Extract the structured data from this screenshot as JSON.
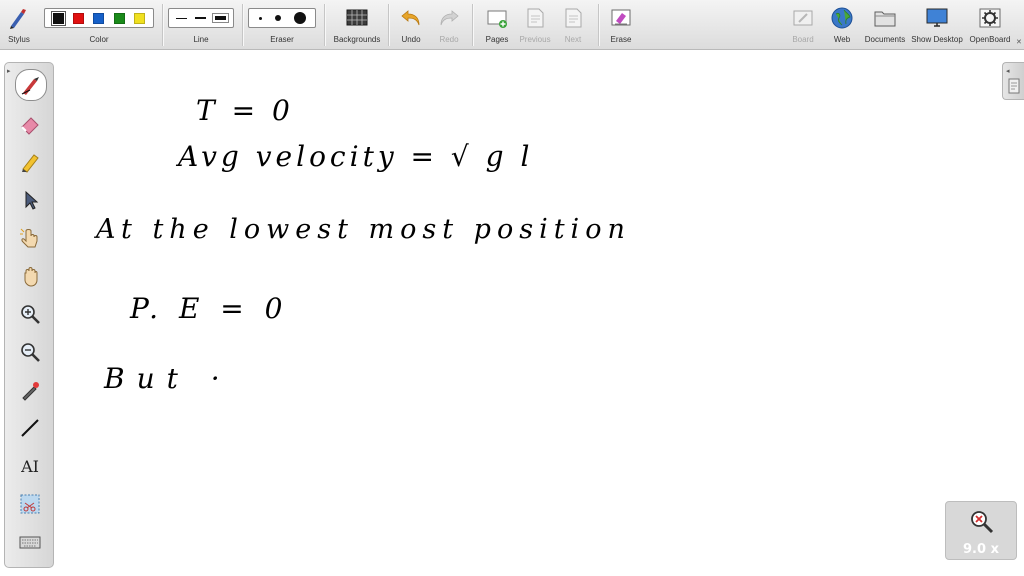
{
  "toolbar": {
    "stylus": "Stylus",
    "color": "Color",
    "line": "Line",
    "eraser": "Eraser",
    "backgrounds": "Backgrounds",
    "undo": "Undo",
    "redo": "Redo",
    "pages": "Pages",
    "previous": "Previous",
    "next": "Next",
    "erase": "Erase",
    "board": "Board",
    "web": "Web",
    "documents": "Documents",
    "show_desktop": "Show Desktop",
    "openboard": "OpenBoard"
  },
  "colors": {
    "swatches": [
      "#111111",
      "#e01010",
      "#1660c8",
      "#1a8a1a",
      "#f0e020"
    ],
    "selected_index": 0
  },
  "palette": {
    "tools": [
      "pen-icon",
      "eraser-icon",
      "marker-icon",
      "pointer-icon",
      "hand-pointer-icon",
      "hand-icon",
      "zoom-in-icon",
      "zoom-out-icon",
      "laser-icon",
      "line-icon",
      "text-icon",
      "capture-icon",
      "keyboard-icon"
    ],
    "text_tool_label": "AI"
  },
  "zoom": {
    "label": "9.0 x"
  },
  "board": {
    "lines": [
      "T = 0",
      "Avg velocity = √ g l",
      "At the lowest most position",
      "P. E = 0",
      "But ·"
    ]
  }
}
